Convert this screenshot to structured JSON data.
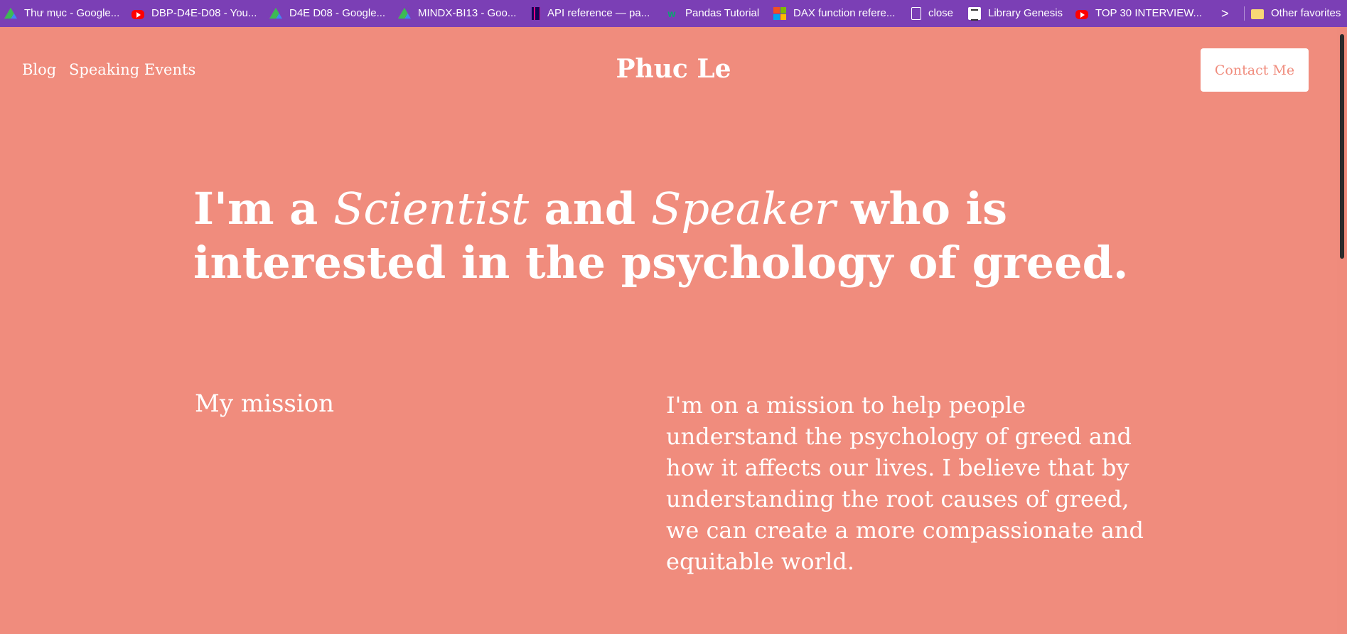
{
  "bookmarks": [
    {
      "label": "Thư mục - Google...",
      "icon": "google-drive-icon"
    },
    {
      "label": "DBP-D4E-D08 - You...",
      "icon": "youtube-icon"
    },
    {
      "label": "D4E D08 - Google...",
      "icon": "google-drive-icon"
    },
    {
      "label": "MINDX-BI13 - Goo...",
      "icon": "google-drive-icon"
    },
    {
      "label": "API reference — pa...",
      "icon": "pandas-icon"
    },
    {
      "label": "Pandas Tutorial",
      "icon": "w3schools-icon"
    },
    {
      "label": "DAX function refere...",
      "icon": "microsoft-icon"
    },
    {
      "label": "close",
      "icon": "file-icon"
    },
    {
      "label": "Library Genesis",
      "icon": "library-genesis-icon"
    },
    {
      "label": "TOP 30 INTERVIEW...",
      "icon": "youtube-icon"
    }
  ],
  "bookmarks_more": ">",
  "other_favorites": "Other favorites",
  "nav": {
    "blog": "Blog",
    "speaking_events": "Speaking Events",
    "brand": "Phuc Le",
    "contact": "Contact Me"
  },
  "hero": {
    "part1": "I'm a ",
    "role1": "Scientist",
    "part2": " and ",
    "role2": "Speaker",
    "part3": " who is interested in the psychology of greed."
  },
  "mission": {
    "label": "My mission",
    "text": "I'm on a mission to help people understand the psychology of greed and how it affects our lives. I believe that by understanding the root causes of greed, we can create a more compassionate and equitable world."
  },
  "colors": {
    "background": "#f08c7d",
    "bookmarks_bar": "#7b3fb5",
    "text": "#ffffff"
  }
}
